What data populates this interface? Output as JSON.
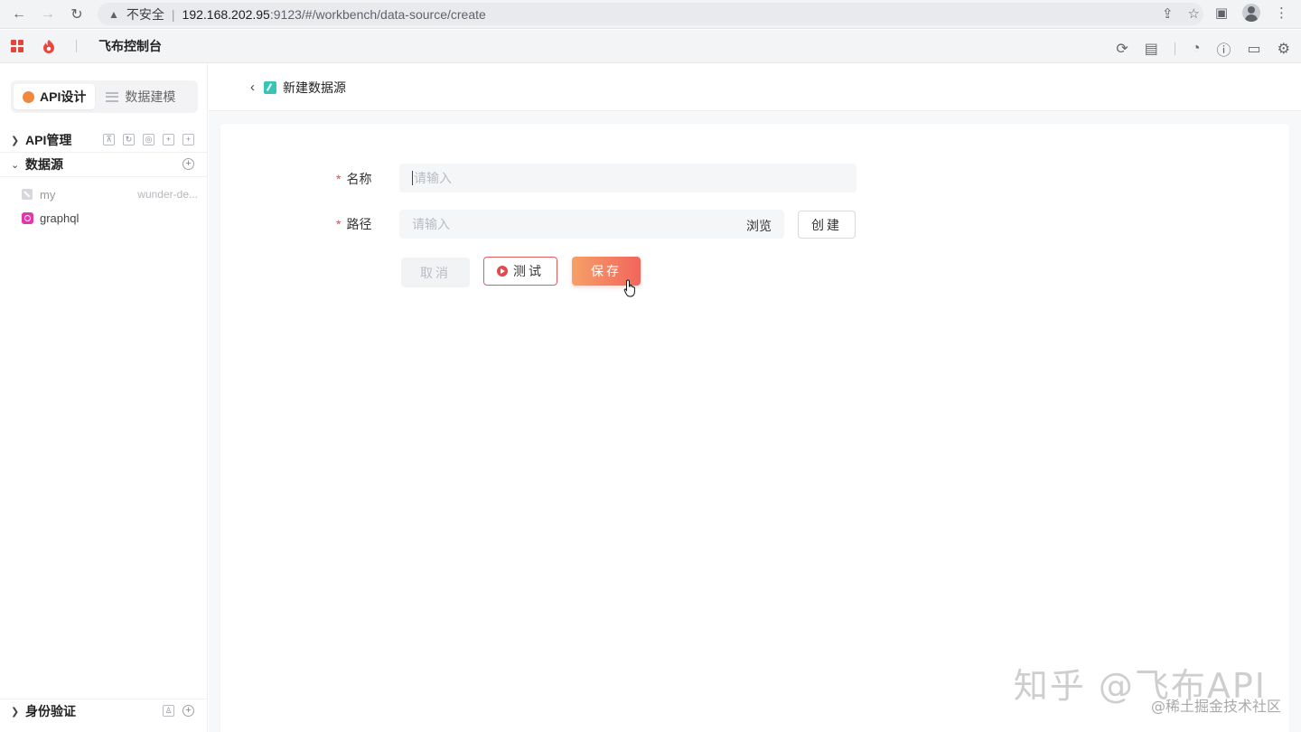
{
  "browser": {
    "security_label": "不安全",
    "url_host": "192.168.202.95",
    "url_path": ":9123/#/workbench/data-source/create"
  },
  "header": {
    "title": "飞布控制台"
  },
  "sidebar": {
    "tabs": [
      {
        "label": "API设计",
        "active": true
      },
      {
        "label": "数据建模",
        "active": false
      }
    ],
    "sections": {
      "api": {
        "label": "API管理"
      },
      "datasource": {
        "label": "数据源"
      },
      "auth": {
        "label": "身份验证"
      }
    },
    "datasources": [
      {
        "name": "my",
        "sub": "wunder-de...",
        "icon": "disabled-db-icon"
      },
      {
        "name": "graphql",
        "sub": "",
        "icon": "graphql-icon"
      }
    ]
  },
  "page": {
    "title": "新建数据源",
    "form": {
      "name_label": "名称",
      "name_placeholder": "请输入",
      "path_label": "路径",
      "path_placeholder": "请输入",
      "browse_label": "浏览",
      "create_label": "创建",
      "cancel_label": "取消",
      "test_label": "测试",
      "save_label": "保存"
    }
  },
  "watermark": {
    "main": "知乎 @飞布API",
    "sub": "@稀土掘金技术社区"
  },
  "colors": {
    "accent": "#f2655c",
    "graphql": "#e535ab",
    "required": "#e5484d"
  }
}
